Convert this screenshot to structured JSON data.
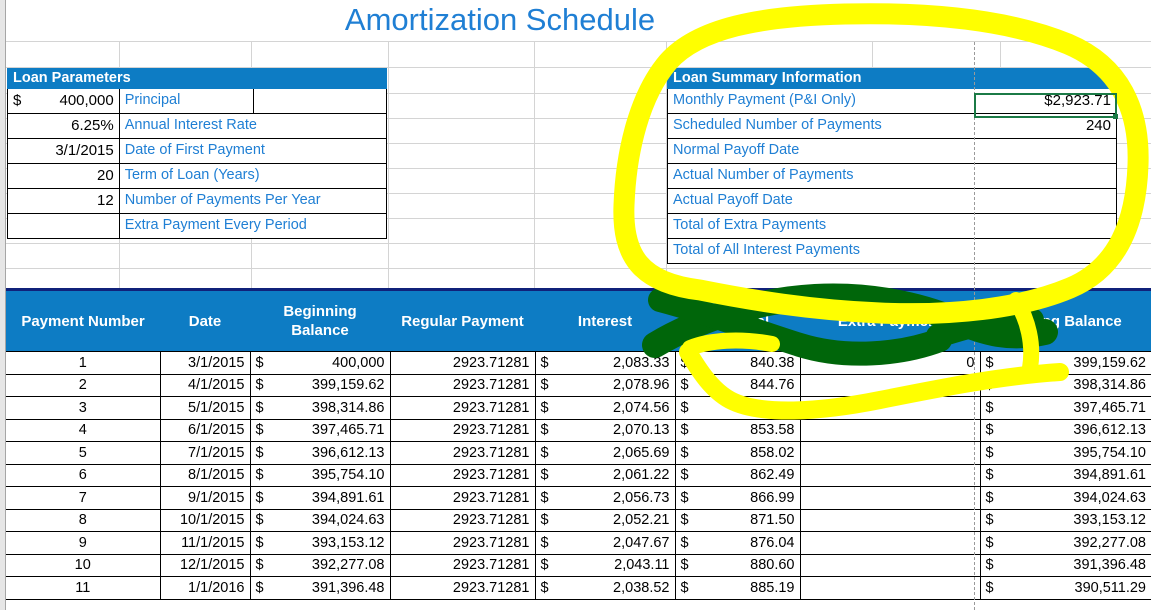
{
  "title": "Amortization Schedule",
  "loan_parameters": {
    "header": "Loan Parameters",
    "rows": [
      {
        "value": "400,000",
        "currency": true,
        "label": "Principal",
        "has_extra_cell": true
      },
      {
        "value": "6.25%",
        "currency": false,
        "label": "Annual Interest Rate",
        "has_extra_cell": false
      },
      {
        "value": "3/1/2015",
        "currency": false,
        "label": "Date of First Payment",
        "has_extra_cell": false
      },
      {
        "value": "20",
        "currency": false,
        "label": "Term of Loan (Years)",
        "has_extra_cell": false
      },
      {
        "value": "12",
        "currency": false,
        "label": "Number of Payments Per Year",
        "has_extra_cell": false
      },
      {
        "value": "",
        "currency": false,
        "label": "Extra Payment Every Period",
        "has_extra_cell": false
      }
    ]
  },
  "loan_summary": {
    "header": "Loan Summary Information",
    "rows": [
      {
        "label": "Monthly Payment (P&I Only)",
        "value": "$2,923.71",
        "selected": true
      },
      {
        "label": "Scheduled Number of Payments",
        "value": "240",
        "selected": false
      },
      {
        "label": "Normal Payoff Date",
        "value": "",
        "selected": false
      },
      {
        "label": "Actual Number of Payments",
        "value": "",
        "selected": false
      },
      {
        "label": "Actual Payoff Date",
        "value": "",
        "selected": false
      },
      {
        "label": "Total of Extra Payments",
        "value": "",
        "selected": false
      },
      {
        "label": "Total of All Interest Payments",
        "value": "",
        "selected": false
      }
    ]
  },
  "schedule": {
    "columns": [
      "Payment Number",
      "Date",
      "Beginning Balance",
      "Regular Payment",
      "Interest",
      "Principal",
      "Extra Payment",
      "Ending Balance"
    ],
    "rows": [
      {
        "number": "1",
        "date": "3/1/2015",
        "beginning_balance": "400,000",
        "regular_payment": "2923.71281",
        "interest": "2,083.33",
        "principal": "840.38",
        "extra_payment": "0",
        "ending_balance": "399,159.62"
      },
      {
        "number": "2",
        "date": "4/1/2015",
        "beginning_balance": "399,159.62",
        "regular_payment": "2923.71281",
        "interest": "2,078.96",
        "principal": "844.76",
        "extra_payment": "",
        "ending_balance": "398,314.86"
      },
      {
        "number": "3",
        "date": "5/1/2015",
        "beginning_balance": "398,314.86",
        "regular_payment": "2923.71281",
        "interest": "2,074.56",
        "principal": "849.16",
        "extra_payment": "",
        "ending_balance": "397,465.71"
      },
      {
        "number": "4",
        "date": "6/1/2015",
        "beginning_balance": "397,465.71",
        "regular_payment": "2923.71281",
        "interest": "2,070.13",
        "principal": "853.58",
        "extra_payment": "",
        "ending_balance": "396,612.13"
      },
      {
        "number": "5",
        "date": "7/1/2015",
        "beginning_balance": "396,612.13",
        "regular_payment": "2923.71281",
        "interest": "2,065.69",
        "principal": "858.02",
        "extra_payment": "",
        "ending_balance": "395,754.10"
      },
      {
        "number": "6",
        "date": "8/1/2015",
        "beginning_balance": "395,754.10",
        "regular_payment": "2923.71281",
        "interest": "2,061.22",
        "principal": "862.49",
        "extra_payment": "",
        "ending_balance": "394,891.61"
      },
      {
        "number": "7",
        "date": "9/1/2015",
        "beginning_balance": "394,891.61",
        "regular_payment": "2923.71281",
        "interest": "2,056.73",
        "principal": "866.99",
        "extra_payment": "",
        "ending_balance": "394,024.63"
      },
      {
        "number": "8",
        "date": "10/1/2015",
        "beginning_balance": "394,024.63",
        "regular_payment": "2923.71281",
        "interest": "2,052.21",
        "principal": "871.50",
        "extra_payment": "",
        "ending_balance": "393,153.12"
      },
      {
        "number": "9",
        "date": "11/1/2015",
        "beginning_balance": "393,153.12",
        "regular_payment": "2923.71281",
        "interest": "2,047.67",
        "principal": "876.04",
        "extra_payment": "",
        "ending_balance": "392,277.08"
      },
      {
        "number": "10",
        "date": "12/1/2015",
        "beginning_balance": "392,277.08",
        "regular_payment": "2923.71281",
        "interest": "2,043.11",
        "principal": "880.60",
        "extra_payment": "",
        "ending_balance": "391,396.48"
      },
      {
        "number": "11",
        "date": "1/1/2016",
        "beginning_balance": "391,396.48",
        "regular_payment": "2923.71281",
        "interest": "2,038.52",
        "principal": "885.19",
        "extra_payment": "",
        "ending_balance": "390,511.29"
      }
    ]
  },
  "annotations": {
    "highlighter_color": "#ffff00",
    "blend_color": "#00660a",
    "shapes": [
      {
        "name": "summary-circle-annotation",
        "type": "ellipse-stroke"
      },
      {
        "name": "header-scribble-annotation",
        "type": "zigzag-stroke"
      }
    ]
  },
  "colors": {
    "header_blue": "#0d7cc4",
    "label_blue": "#1f7fd4",
    "title_blue": "#1f7fd4",
    "selection_green": "#1b7a46",
    "top_rule_navy": "#10217a"
  }
}
